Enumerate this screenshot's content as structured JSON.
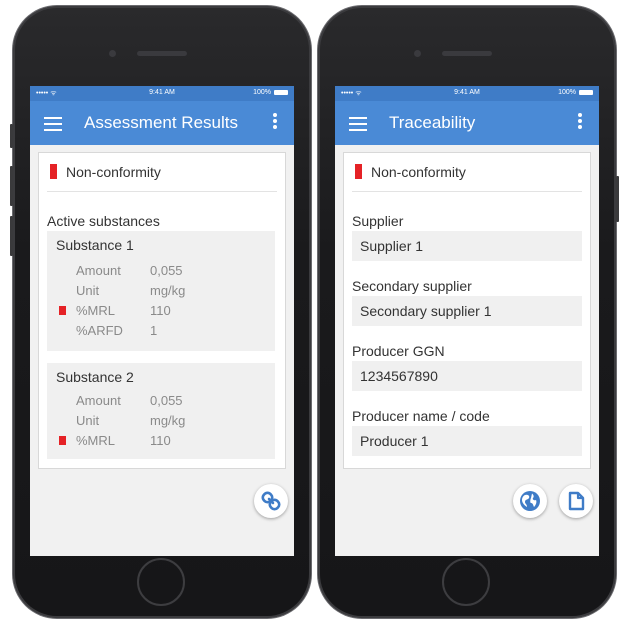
{
  "status": {
    "carrier": "••••• ᯤ",
    "time": "9:41 AM",
    "battery": "100%"
  },
  "colors": {
    "accent": "#4a8ad6",
    "status_bar": "#3f7cc7",
    "nonconformity": "#e52226"
  },
  "left_screen": {
    "title": "Assessment Results",
    "nonconformity_label": "Non-conformity",
    "section_label": "Active substances",
    "substances": [
      {
        "name": "Substance 1",
        "rows": [
          {
            "key": "Amount",
            "value": "0,055",
            "flagged": false
          },
          {
            "key": "Unit",
            "value": "mg/kg",
            "flagged": false
          },
          {
            "key": "%MRL",
            "value": "110",
            "flagged": true
          },
          {
            "key": "%ARFD",
            "value": "1",
            "flagged": false
          }
        ]
      },
      {
        "name": "Substance 2",
        "rows": [
          {
            "key": "Amount",
            "value": "0,055",
            "flagged": false
          },
          {
            "key": "Unit",
            "value": "mg/kg",
            "flagged": false
          },
          {
            "key": "%MRL",
            "value": "110",
            "flagged": true
          }
        ]
      }
    ],
    "fab_icon": "link-icon"
  },
  "right_screen": {
    "title": "Traceability",
    "nonconformity_label": "Non-conformity",
    "fields": [
      {
        "label": "Supplier",
        "value": "Supplier 1"
      },
      {
        "label": "Secondary supplier",
        "value": "Secondary supplier 1"
      },
      {
        "label": "Producer GGN",
        "value": "1234567890"
      },
      {
        "label": "Producer name / code",
        "value": "Producer 1"
      }
    ],
    "fab_icons": [
      "globe-icon",
      "document-icon"
    ]
  }
}
